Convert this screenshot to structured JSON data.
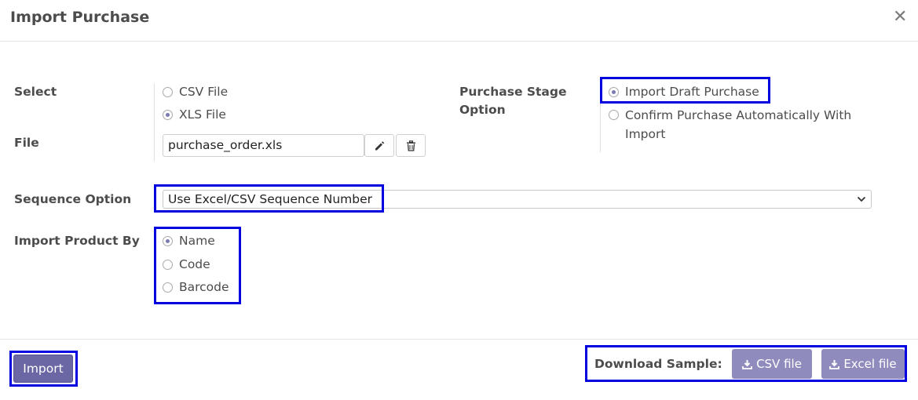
{
  "dialog": {
    "title": "Import Purchase",
    "close_glyph": "✕"
  },
  "form": {
    "select_label": "Select",
    "file_label": "File",
    "file_type_options": [
      {
        "label": "CSV File",
        "checked": false
      },
      {
        "label": "XLS File",
        "checked": true
      }
    ],
    "file_value": "purchase_order.xls",
    "stage_label_line1": "Purchase Stage",
    "stage_label_line2": "Option",
    "stage_options": [
      {
        "label": "Import Draft Purchase",
        "checked": true
      },
      {
        "label_line1": "Confirm Purchase Automatically With",
        "label_line2": "Import",
        "checked": false
      }
    ],
    "sequence_label": "Sequence Option",
    "sequence_value": "Use Excel/CSV Sequence Number",
    "product_label": "Import Product By",
    "product_options": [
      {
        "label": "Name",
        "checked": true
      },
      {
        "label": "Code",
        "checked": false
      },
      {
        "label": "Barcode",
        "checked": false
      }
    ]
  },
  "footer": {
    "import_label": "Import",
    "download_label": "Download Sample:",
    "csv_label": "CSV file",
    "excel_label": "Excel file"
  },
  "colors": {
    "highlight": "#0000e0",
    "primary": "#6b66a4",
    "secondary": "#8f8bbd"
  },
  "icons": [
    "close-icon",
    "pencil-icon",
    "trash-icon",
    "chevron-down-icon",
    "download-icon"
  ]
}
